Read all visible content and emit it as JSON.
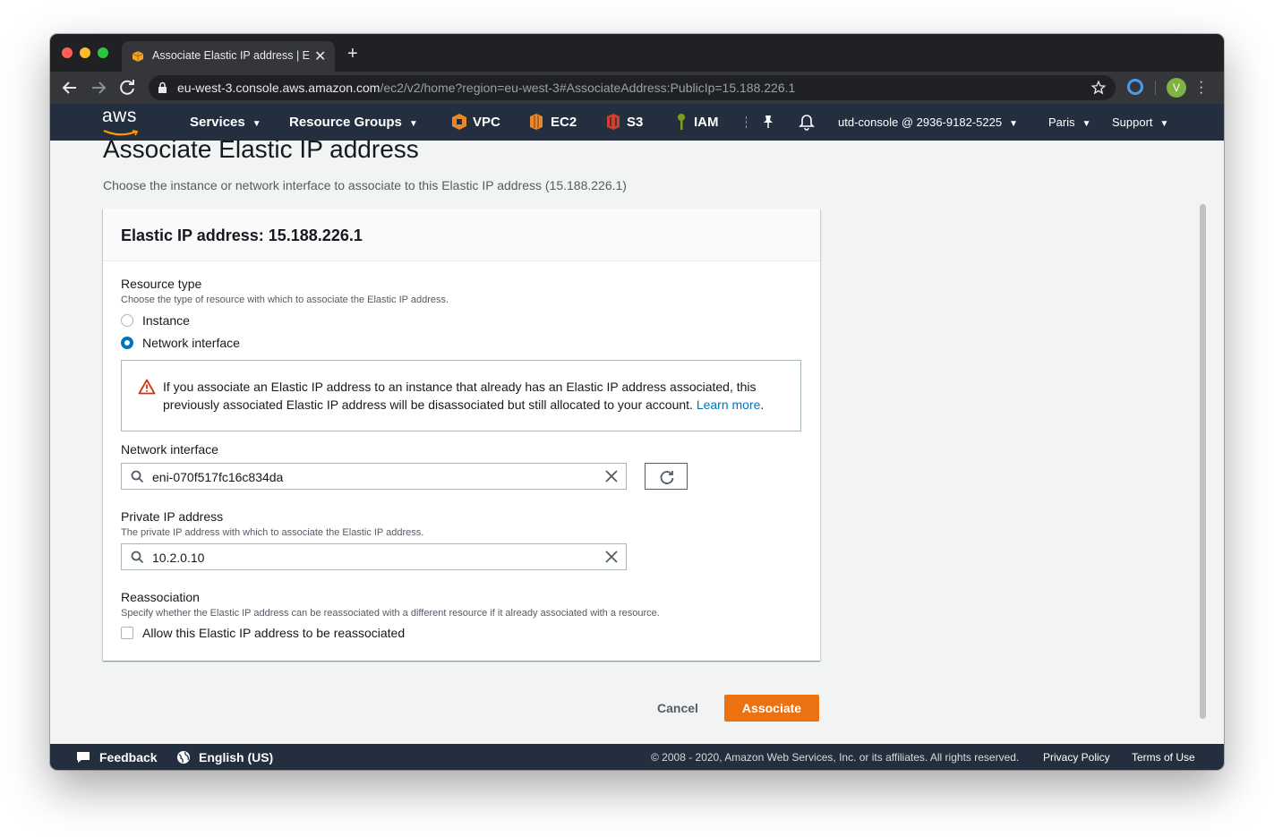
{
  "browser": {
    "tab_title": "Associate Elastic IP address | E",
    "url_host": "eu-west-3.console.aws.amazon.com",
    "url_path": "/ec2/v2/home?region=eu-west-3#AssociateAddress:PublicIp=15.188.226.1",
    "profile_initial": "V"
  },
  "aws_nav": {
    "logo_text": "aws",
    "services": "Services",
    "resource_groups": "Resource Groups",
    "pins": [
      "VPC",
      "EC2",
      "S3",
      "IAM"
    ],
    "account": "utd-console @ 2936-9182-5225",
    "region": "Paris",
    "support": "Support"
  },
  "page": {
    "title": "Associate Elastic IP address",
    "description": "Choose the instance or network interface to associate to this Elastic IP address (15.188.226.1)",
    "panel_title": "Elastic IP address: 15.188.226.1",
    "resource_type": {
      "label": "Resource type",
      "description": "Choose the type of resource with which to associate the Elastic IP address.",
      "options": [
        "Instance",
        "Network interface"
      ],
      "selected": "Network interface"
    },
    "alert": {
      "text": "If you associate an Elastic IP address to an instance that already has an Elastic IP address associated, this previously associated Elastic IP address will be disassociated but still allocated to your account.",
      "link": "Learn more",
      "period": "."
    },
    "network_interface": {
      "label": "Network interface",
      "value": "eni-070f517fc16c834da"
    },
    "private_ip": {
      "label": "Private IP address",
      "description": "The private IP address with which to associate the Elastic IP address.",
      "value": "10.2.0.10"
    },
    "reassociation": {
      "label": "Reassociation",
      "description": "Specify whether the Elastic IP address can be reassociated with a different resource if it already associated with a resource.",
      "checkbox_label": "Allow this Elastic IP address to be reassociated",
      "checked": false
    },
    "cancel": "Cancel",
    "associate": "Associate"
  },
  "footer": {
    "feedback": "Feedback",
    "language": "English (US)",
    "copyright": "© 2008 - 2020, Amazon Web Services, Inc. or its affiliates. All rights reserved.",
    "privacy": "Privacy Policy",
    "terms": "Terms of Use"
  },
  "colors": {
    "primary": "#ec7211",
    "link": "#0073bb",
    "nav_bg": "#232f3e",
    "warning": "#d13212"
  }
}
